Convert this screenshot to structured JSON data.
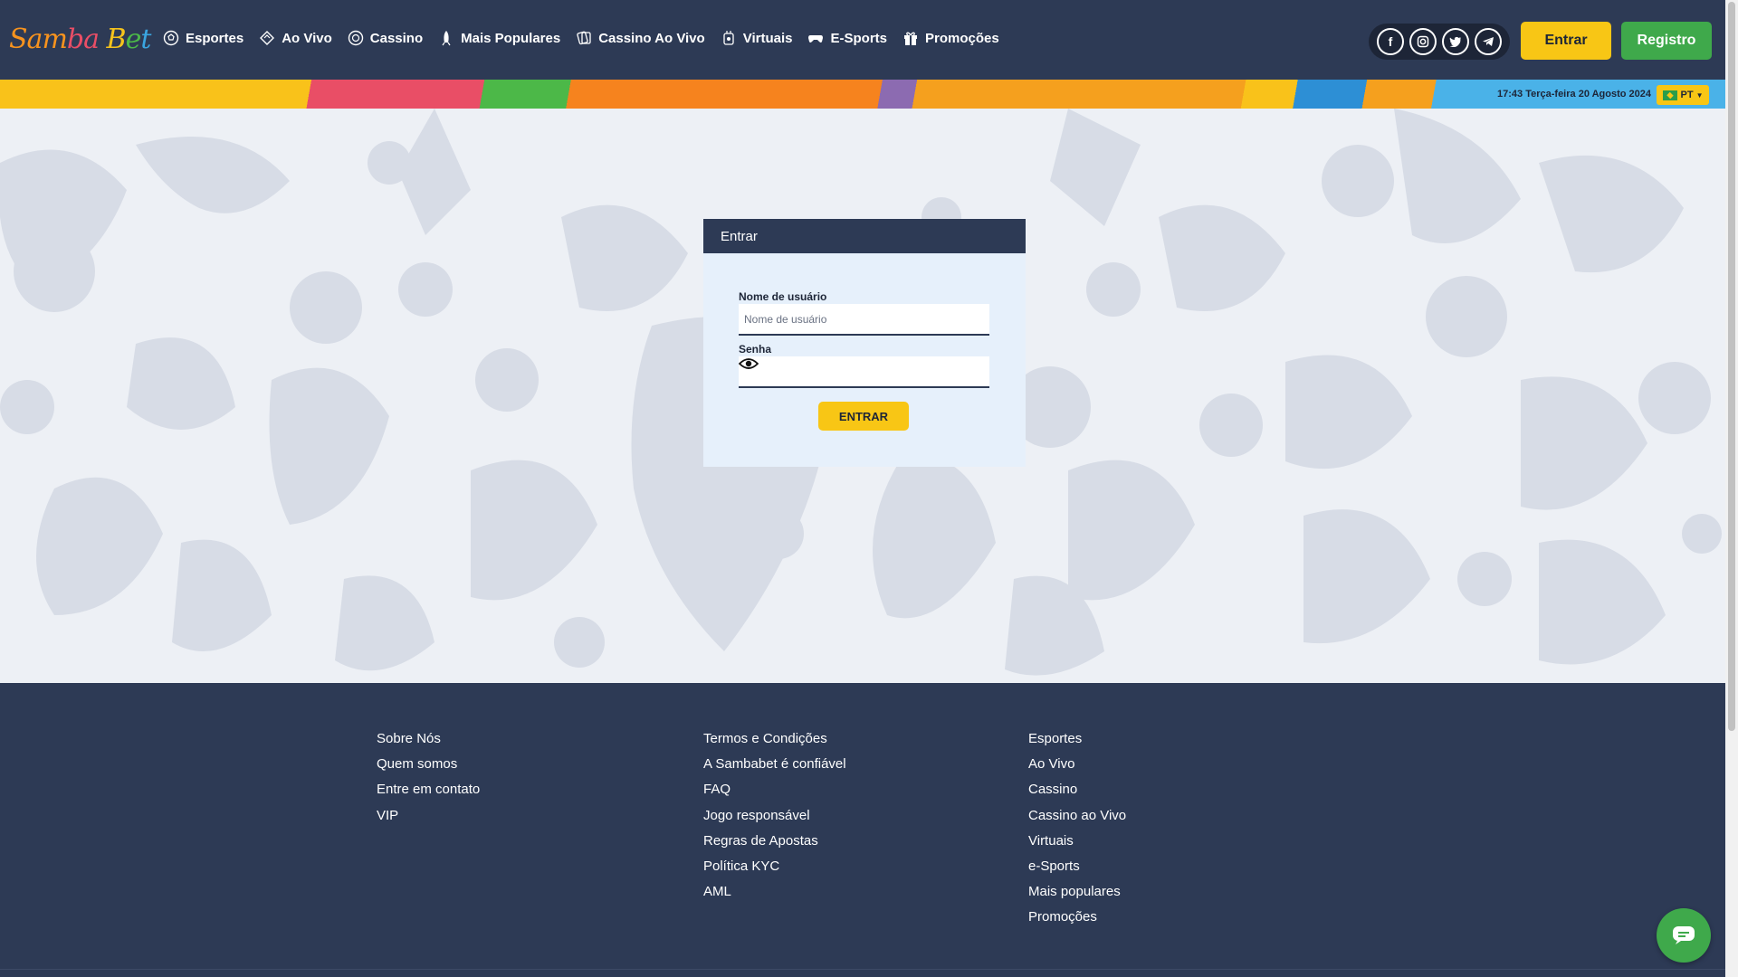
{
  "header": {
    "logo_text": [
      "Sam",
      "ba",
      " B",
      "e",
      "t"
    ],
    "nav": [
      {
        "label": "Esportes",
        "icon": "soccer-ball-icon"
      },
      {
        "label": "Ao Vivo",
        "icon": "live-ticket-icon"
      },
      {
        "label": "Cassino",
        "icon": "casino-chip-icon"
      },
      {
        "label": "Mais Populares",
        "icon": "rocket-icon"
      },
      {
        "label": "Cassino Ao Vivo",
        "icon": "cards-icon"
      },
      {
        "label": "Virtuais",
        "icon": "virtual-icon"
      },
      {
        "label": "E-Sports",
        "icon": "gamepad-icon"
      },
      {
        "label": "Promoções",
        "icon": "gift-icon"
      }
    ],
    "social": [
      "facebook-icon",
      "instagram-icon",
      "twitter-icon",
      "telegram-icon"
    ],
    "login_button": "Entrar",
    "register_button": "Registro"
  },
  "topbar": {
    "datetime": "17:43 Terça-feira 20 Agosto 2024",
    "language": "PT"
  },
  "login": {
    "title": "Entrar",
    "username_label": "Nome de usuário",
    "username_placeholder": "Nome de usuário",
    "password_label": "Senha",
    "submit": "ENTRAR"
  },
  "footer": {
    "col1": [
      "Sobre Nós",
      "Quem somos",
      "Entre em contato",
      "VIP"
    ],
    "col2": [
      "Termos e Condições",
      "A Sambabet é confiável",
      "FAQ",
      "Jogo responsável",
      "Regras de Apostas",
      "Política KYC",
      "AML"
    ],
    "col3": [
      "Esportes",
      "Ao Vivo",
      "Cassino",
      "Cassino ao Vivo",
      "Virtuais",
      "e-Sports",
      "Mais populares",
      "Promoções"
    ]
  },
  "colors": {
    "header_bg": "#2d3a55",
    "accent_yellow": "#f8c615",
    "accent_green": "#3fa94b",
    "main_bg": "#edf0f5",
    "panel_bg": "#e6f0fb"
  }
}
